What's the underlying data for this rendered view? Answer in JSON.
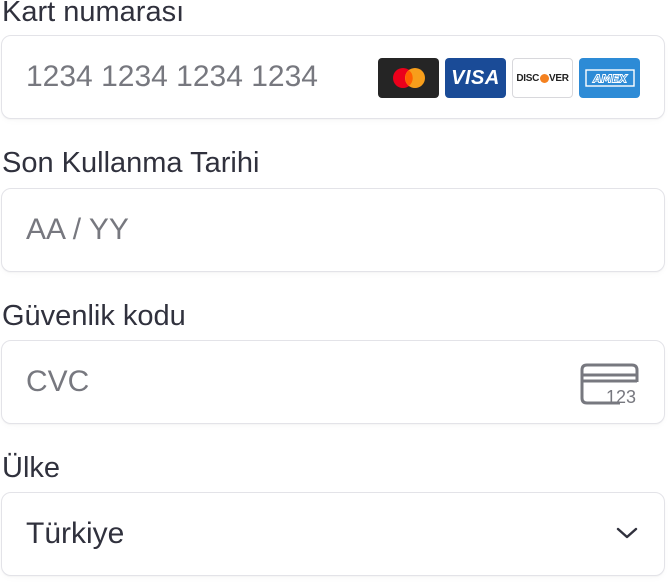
{
  "card_number": {
    "label": "Kart numarası",
    "placeholder": "1234 1234 1234 1234",
    "value": "",
    "brands": [
      {
        "name": "mastercard",
        "icon": "mastercard-logo-icon"
      },
      {
        "name": "VISA",
        "icon": "visa-logo-icon"
      },
      {
        "name": "DISCOVER",
        "icon": "discover-logo-icon"
      },
      {
        "name": "AMEX",
        "icon": "amex-logo-icon"
      }
    ]
  },
  "expiry": {
    "label": "Son Kullanma Tarihi",
    "placeholder": "AA / YY",
    "value": ""
  },
  "cvc": {
    "label": "Güvenlik kodu",
    "placeholder": "CVC",
    "value": "",
    "icon": "cvc-card-icon",
    "icon_text": "123"
  },
  "country": {
    "label": "Ülke",
    "selected": "Türkiye",
    "icon": "chevron-down-icon"
  },
  "colors": {
    "text": "#30313d",
    "placeholder": "#77787f",
    "border": "#e3e3e8",
    "visa_blue": "#1a4b97",
    "amex_blue": "#2d8bd6",
    "mastercard_red": "#eb001b",
    "mastercard_orange": "#f79e1b",
    "discover_orange": "#f48120"
  }
}
